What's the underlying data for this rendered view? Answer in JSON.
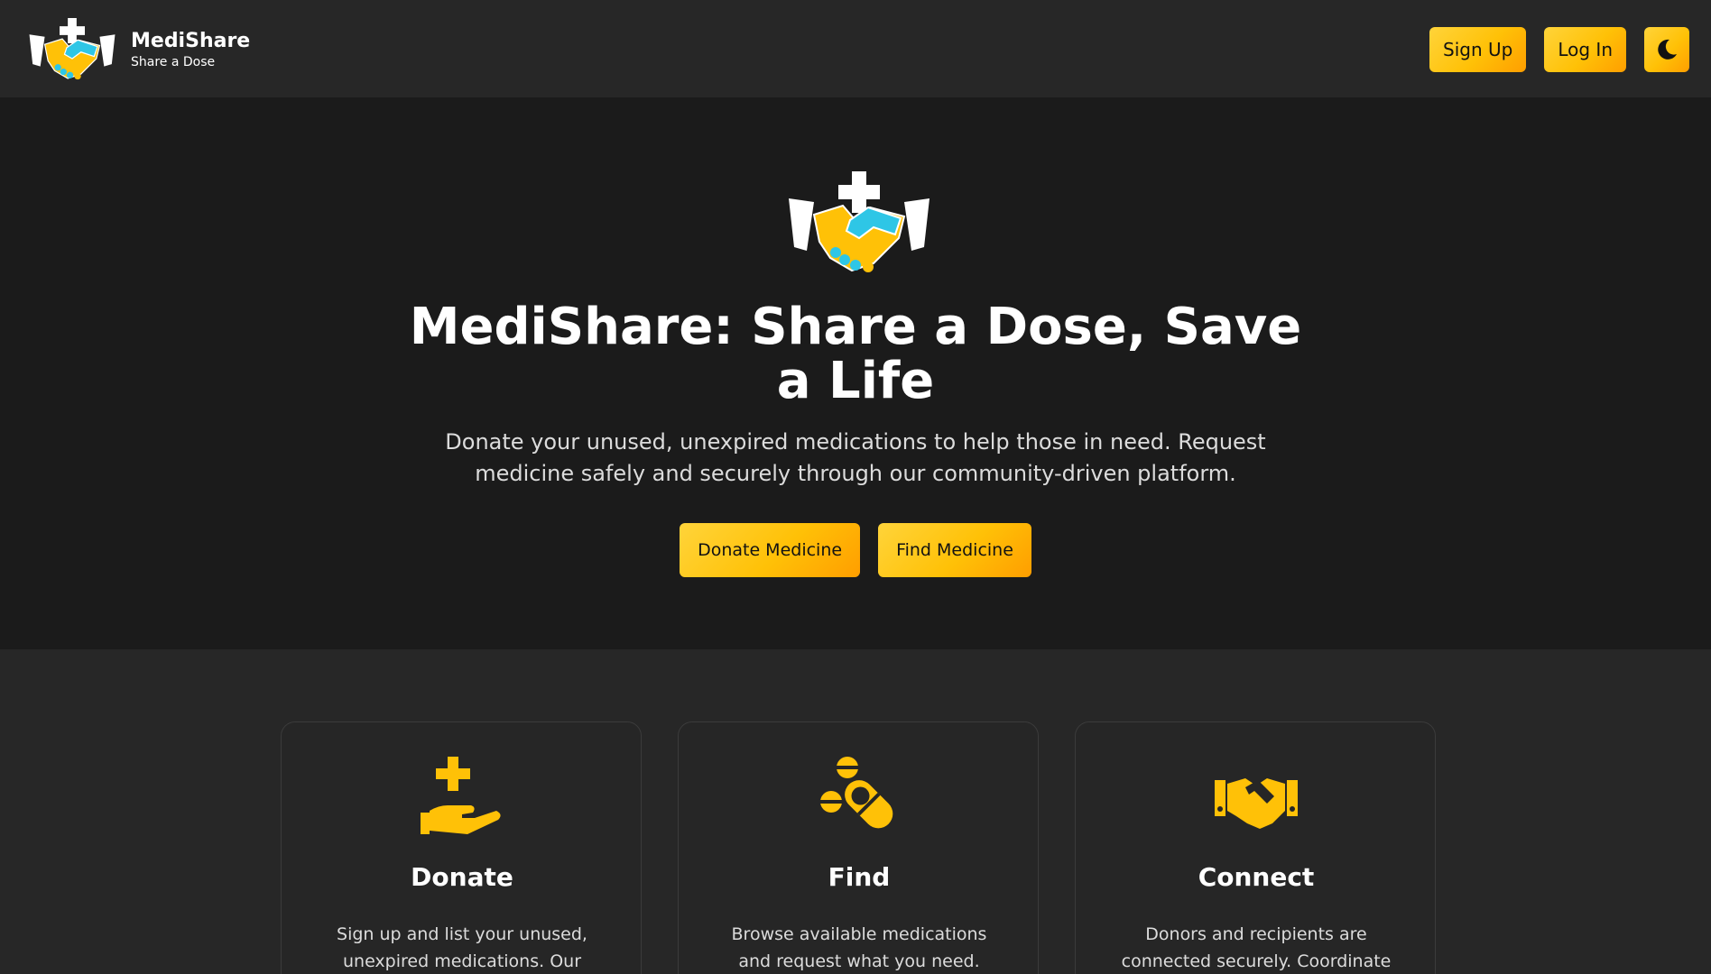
{
  "brand": {
    "name": "MediShare",
    "tagline": "Share a Dose"
  },
  "nav": {
    "signup_label": "Sign Up",
    "login_label": "Log In",
    "theme_toggle_icon": "moon-icon"
  },
  "hero": {
    "title": "MediShare: Share a Dose, Save a Life",
    "subtitle": "Donate your unused, unexpired medications to help those in need. Request medicine safely and securely through our community-driven platform.",
    "donate_label": "Donate Medicine",
    "find_label": "Find Medicine"
  },
  "features": [
    {
      "icon": "hand-plus-icon",
      "title": "Donate",
      "description": "Sign up and list your unused, unexpired medications. Our"
    },
    {
      "icon": "pills-icon",
      "title": "Find",
      "description": "Browse available medications and request what you need. We verify"
    },
    {
      "icon": "handshake-icon",
      "title": "Connect",
      "description": "Donors and recipients are connected securely. Coordinate"
    }
  ],
  "colors": {
    "accent": "#ffc107",
    "accent_end": "#ff9e00",
    "header_bg": "#272727",
    "hero_bg": "#1b1b1b",
    "handshake_blue": "#2ec6e6"
  }
}
